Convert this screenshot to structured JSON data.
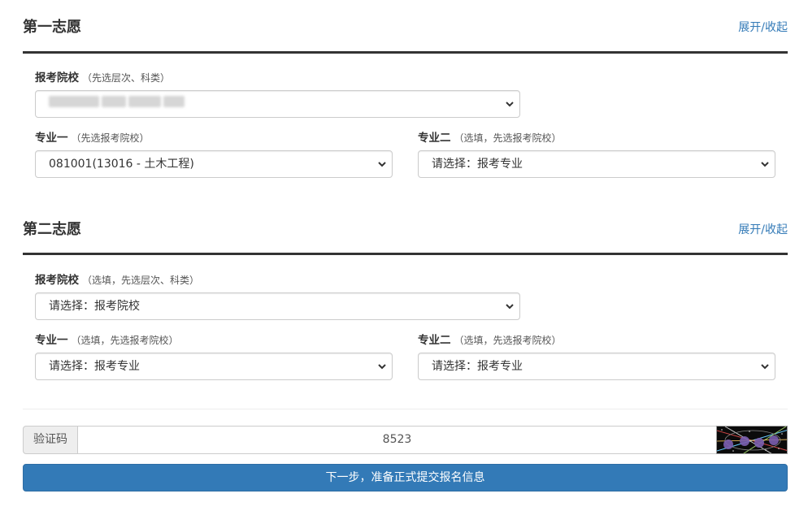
{
  "choice1": {
    "title": "第一志愿",
    "toggle": "展开/收起",
    "school": {
      "label": "报考院校",
      "hint": "（先选层次、科类）",
      "value": ""
    },
    "major1": {
      "label": "专业一",
      "hint": "（先选报考院校）",
      "value": "081001(13016 - 土木工程)"
    },
    "major2": {
      "label": "专业二",
      "hint": "（选填，先选报考院校）",
      "value": "请选择：报考专业"
    }
  },
  "choice2": {
    "title": "第二志愿",
    "toggle": "展开/收起",
    "school": {
      "label": "报考院校",
      "hint": "（选填，先选层次、科类）",
      "value": "请选择：报考院校"
    },
    "major1": {
      "label": "专业一",
      "hint": "（选填，先选报考院校）",
      "value": "请选择：报考专业"
    },
    "major2": {
      "label": "专业二",
      "hint": "（选填，先选报考院校）",
      "value": "请选择：报考专业"
    }
  },
  "captcha": {
    "label": "验证码",
    "value": "8523"
  },
  "submit_label": "下一步，准备正式提交报名信息",
  "colors": {
    "link": "#337ab7",
    "primary": "#337ab7",
    "rule": "#333333"
  },
  "icons": {
    "select_arrow": "chevron-down-icon",
    "captcha": "captcha-image"
  }
}
